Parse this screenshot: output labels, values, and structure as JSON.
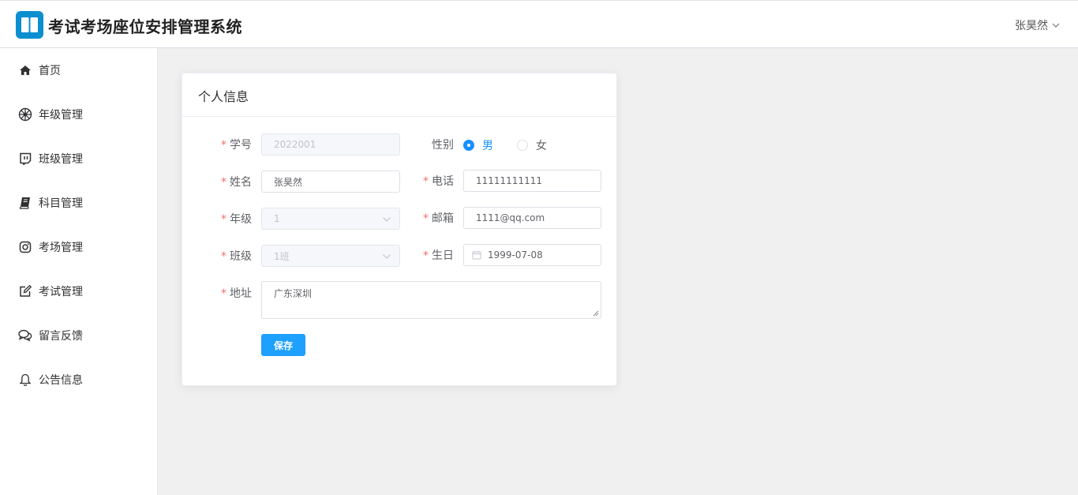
{
  "app": {
    "title": "考试考场座位安排管理系统",
    "user": "张昊然"
  },
  "sidebar": {
    "items": [
      {
        "label": "首页",
        "icon": "home-icon"
      },
      {
        "label": "年级管理",
        "icon": "helm-icon"
      },
      {
        "label": "班级管理",
        "icon": "chat-box-icon"
      },
      {
        "label": "科目管理",
        "icon": "book-icon"
      },
      {
        "label": "考场管理",
        "icon": "instagram-icon"
      },
      {
        "label": "考试管理",
        "icon": "edit-icon"
      },
      {
        "label": "留言反馈",
        "icon": "comments-icon"
      },
      {
        "label": "公告信息",
        "icon": "bell-icon"
      }
    ]
  },
  "profile": {
    "title": "个人信息",
    "student_id": {
      "label": "学号",
      "value": "2022001"
    },
    "gender": {
      "label": "性别",
      "options": [
        "男",
        "女"
      ],
      "selected": "男"
    },
    "name": {
      "label": "姓名",
      "value": "张昊然"
    },
    "phone": {
      "label": "电话",
      "value": "11111111111"
    },
    "grade": {
      "label": "年级",
      "value": "1"
    },
    "email": {
      "label": "邮箱",
      "value": "1111@qq.com"
    },
    "class": {
      "label": "班级",
      "value": "1班"
    },
    "birthday": {
      "label": "生日",
      "value": "1999-07-08"
    },
    "address": {
      "label": "地址",
      "value": "广东深圳"
    },
    "save_label": "保存"
  },
  "colors": {
    "primary": "#1890ff",
    "required": "#f56c6c",
    "logo": "#0b8fd0"
  }
}
